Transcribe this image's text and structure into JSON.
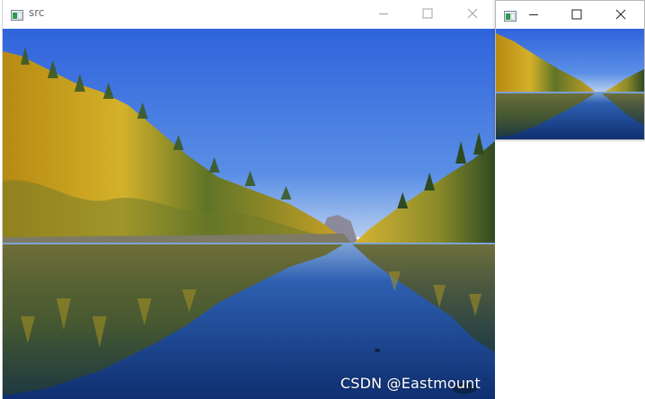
{
  "windows": {
    "main": {
      "title": "src",
      "icon": "app-window-icon",
      "controls": [
        "minimize-icon",
        "maximize-icon",
        "close-icon"
      ]
    },
    "small": {
      "title": "",
      "icon": "app-window-icon",
      "controls": [
        "minimize-icon",
        "maximize-icon",
        "close-icon"
      ]
    }
  },
  "watermark": "CSDN @Eastmount",
  "colors": {
    "sky_top": "#3a6fe0",
    "sky_bottom": "#a9c6f0",
    "forest_gold": "#c8a21f",
    "forest_dark": "#2f4a22",
    "water": "#1b3f86"
  }
}
